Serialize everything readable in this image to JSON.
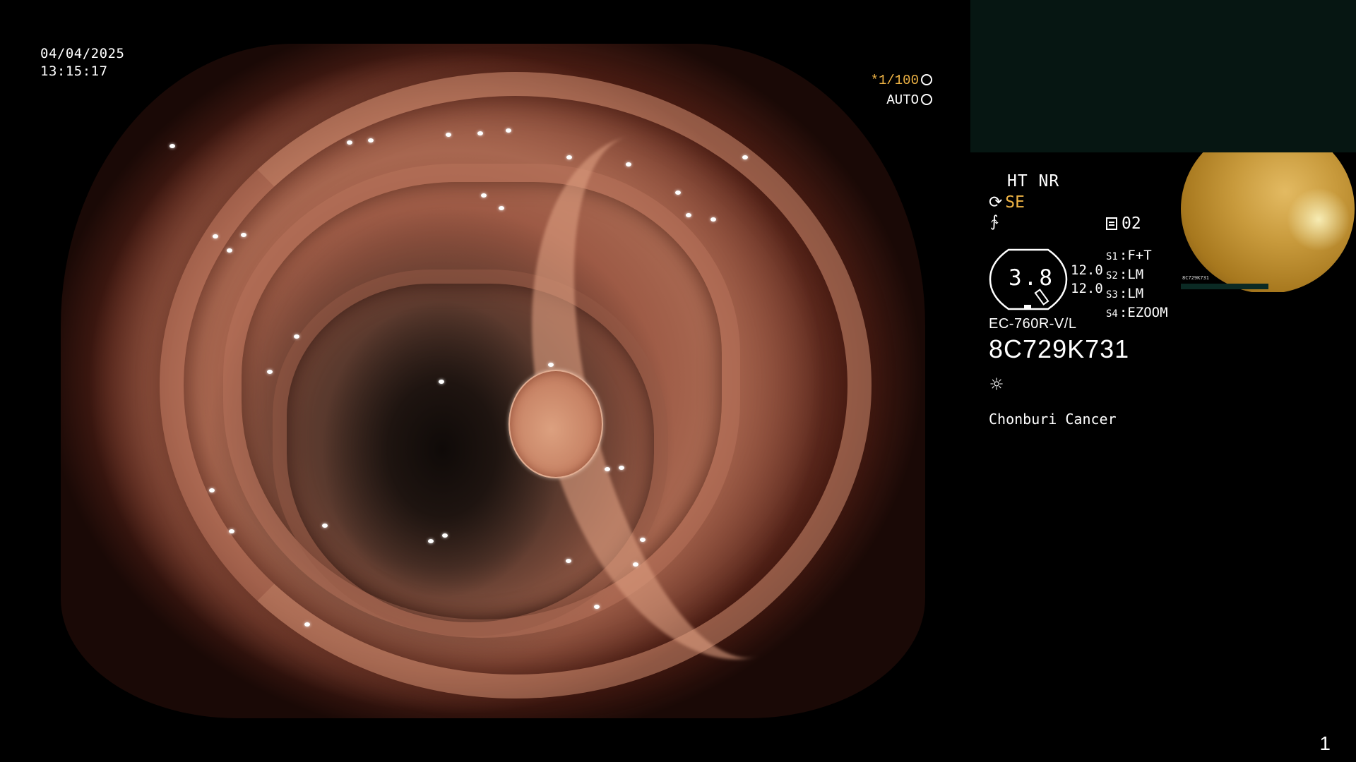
{
  "overlay": {
    "date": "04/04/2025",
    "time": "13:15:17",
    "shutter_speed": "*1/100",
    "exposure_mode": "AUTO"
  },
  "panel": {
    "mode_flags": "HT NR",
    "enhancement": "SE",
    "memory": "02",
    "dial_value": "3.8",
    "gain": [
      "12.0",
      "12.0"
    ],
    "scope_switches": [
      {
        "key": "S1",
        "value": "F+T"
      },
      {
        "key": "S2",
        "value": "LM"
      },
      {
        "key": "S3",
        "value": "LM"
      },
      {
        "key": "S4",
        "value": "EZOOM"
      }
    ],
    "scope_model": "EC-760R-V/L",
    "serial": "8C729K731",
    "hospital": "Chonburi Cancer"
  },
  "thumbnail": {
    "serial": "8C729K731"
  },
  "footer": {
    "page_number": "1"
  },
  "colors": {
    "accent_yellow": "#f0b445",
    "info_box": "#061612"
  },
  "icons": [
    "wb-icon",
    "iris-icon",
    "se-icon",
    "wave-icon",
    "memory-icon",
    "sun-icon"
  ]
}
